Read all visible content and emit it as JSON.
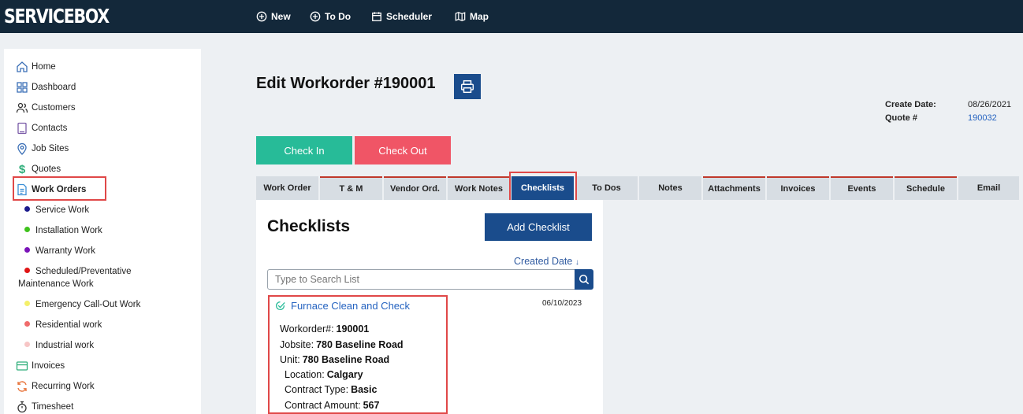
{
  "app": {
    "logo": "SERVICEBOX"
  },
  "topnav": {
    "new": "New",
    "todo": "To Do",
    "scheduler": "Scheduler",
    "map": "Map"
  },
  "sidebar": {
    "items": [
      {
        "label": "Home",
        "icon": "home-icon"
      },
      {
        "label": "Dashboard",
        "icon": "dashboard-icon"
      },
      {
        "label": "Customers",
        "icon": "users-icon"
      },
      {
        "label": "Contacts",
        "icon": "contacts-icon"
      },
      {
        "label": "Job Sites",
        "icon": "location-icon"
      },
      {
        "label": "Quotes",
        "icon": "dollar-icon"
      },
      {
        "label": "Work Orders",
        "icon": "document-icon"
      },
      {
        "label": "Invoices",
        "icon": "invoice-icon"
      },
      {
        "label": "Recurring Work",
        "icon": "recurring-icon"
      },
      {
        "label": "Timesheet",
        "icon": "stopwatch-icon"
      }
    ],
    "work_order_types": [
      {
        "label": "Service Work",
        "color": "#1a1a8c"
      },
      {
        "label": "Installation Work",
        "color": "#3fc21c"
      },
      {
        "label": "Warranty Work",
        "color": "#7a12b8"
      },
      {
        "label": "Scheduled/Preventative",
        "label2": "Maintenance Work",
        "color": "#e01515"
      },
      {
        "label": "Emergency Call-Out Work",
        "color": "#f4f06a"
      },
      {
        "label": "Residential work",
        "color": "#f06b6b"
      },
      {
        "label": "Industrial work",
        "color": "#f7c6c6"
      }
    ]
  },
  "header": {
    "title": "Edit Workorder #190001",
    "create_date_label": "Create Date:",
    "create_date": "08/26/2021",
    "quote_label": "Quote #",
    "quote_value": "190032"
  },
  "actions": {
    "check_in": "Check In",
    "check_out": "Check Out"
  },
  "tabs": [
    "Work Order",
    "T & M",
    "Vendor Ord.",
    "Work Notes",
    "Checklists",
    "To Dos",
    "Notes",
    "Attachments",
    "Invoices",
    "Events",
    "Schedule",
    "Email"
  ],
  "active_tab": "Checklists",
  "checklists": {
    "title": "Checklists",
    "add_button": "Add Checklist",
    "sort_label": "Created Date",
    "sort_arrow": "↓",
    "search_placeholder": "Type to Search List",
    "items": [
      {
        "name": "Furnace Clean and Check",
        "date": "06/10/2023",
        "fields": [
          {
            "label": "Workorder#:",
            "value": "190001"
          },
          {
            "label": "Jobsite:",
            "value": "780 Baseline Road"
          },
          {
            "label": "Unit:",
            "value": "780 Baseline Road"
          },
          {
            "label": "Location:",
            "value": "Calgary"
          },
          {
            "label": "Contract Type:",
            "value": "Basic"
          },
          {
            "label": "Contract Amount:",
            "value": "567"
          }
        ]
      }
    ]
  }
}
